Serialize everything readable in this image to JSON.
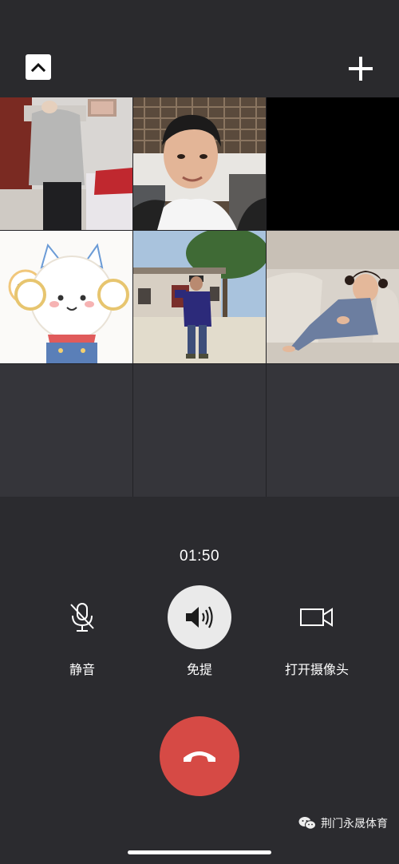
{
  "call": {
    "timer": "01:50"
  },
  "controls": {
    "mute_label": "静音",
    "speaker_label": "免提",
    "camera_label": "打开摄像头",
    "speaker_active": true
  },
  "participants": [
    {
      "kind": "video",
      "description_icon": "person-standing-indoor"
    },
    {
      "kind": "video",
      "description_icon": "young-man-face"
    },
    {
      "kind": "black"
    },
    {
      "kind": "avatar",
      "description_icon": "cartoon-cat-avatar"
    },
    {
      "kind": "video",
      "description_icon": "child-outdoors"
    },
    {
      "kind": "video",
      "description_icon": "toddler-on-sofa"
    },
    {
      "kind": "empty"
    },
    {
      "kind": "empty"
    },
    {
      "kind": "empty"
    }
  ],
  "watermark": {
    "text": "荆门永晟体育",
    "icon": "wechat-icon"
  },
  "colors": {
    "background": "#2b2b2f",
    "hangup": "#d64a45",
    "speaker_active_bg": "#eaeaea"
  }
}
